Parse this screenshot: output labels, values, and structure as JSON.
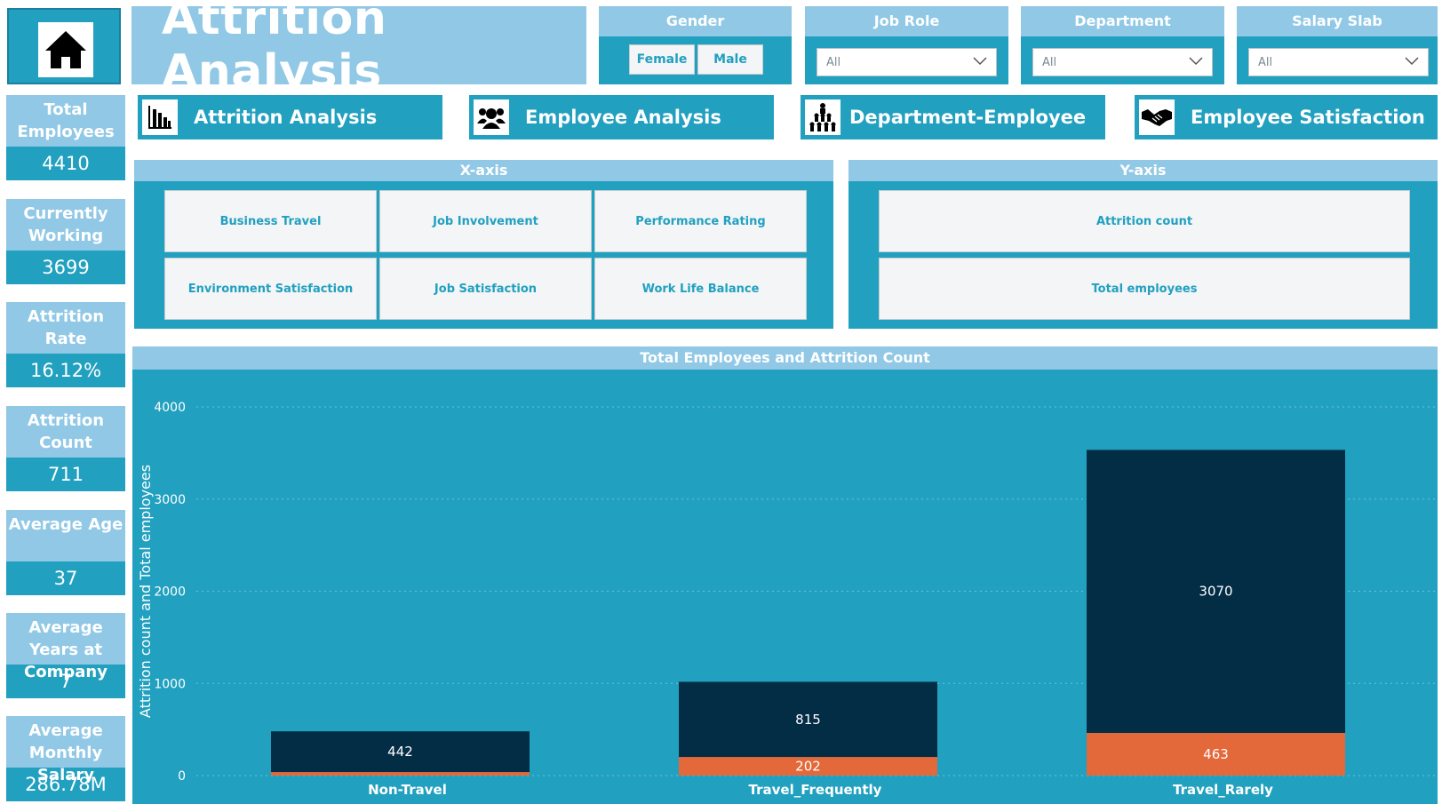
{
  "app": {
    "title": "Attrition Analysis"
  },
  "filters": {
    "gender": {
      "label": "Gender",
      "options": [
        "Female",
        "Male"
      ]
    },
    "job_role": {
      "label": "Job Role",
      "value": "All"
    },
    "department": {
      "label": "Department",
      "value": "All"
    },
    "salary_slab": {
      "label": "Salary Slab",
      "value": "All"
    }
  },
  "nav": [
    {
      "label": "Attrition Analysis",
      "icon": "bar-chart-icon"
    },
    {
      "label": "Employee Analysis",
      "icon": "people-icon"
    },
    {
      "label": "Department-Employee",
      "icon": "org-group-icon"
    },
    {
      "label": "Employee Satisfaction",
      "icon": "handshake-icon"
    }
  ],
  "kpis": [
    {
      "label": "Total Employees",
      "value": "4410"
    },
    {
      "label": "Currently Working",
      "value": "3699"
    },
    {
      "label": "Attrition Rate",
      "value": "16.12%"
    },
    {
      "label": "Attrition Count",
      "value": "711"
    },
    {
      "label": "Average Age",
      "value": "37"
    },
    {
      "label": "Average Years at Company",
      "value": "7"
    },
    {
      "label": "Average Monthly Salary",
      "value": "286.78M"
    }
  ],
  "x_axis": {
    "title": "X-axis",
    "options": [
      "Business Travel",
      "Job Involvement",
      "Performance Rating",
      "Environment Satisfaction",
      "Job Satisfaction",
      "Work Life Balance"
    ]
  },
  "y_axis": {
    "title": "Y-axis",
    "options": [
      "Attrition count",
      "Total employees"
    ]
  },
  "colors": {
    "teal": "#21a0bf",
    "light": "#90c8e6",
    "navy": "#032c45",
    "orange": "#e3683a"
  },
  "chart_data": {
    "type": "bar",
    "stacked": true,
    "title": "Total Employees and Attrition Count",
    "xlabel": "Business Travel",
    "ylabel": "Attrition count and Total employees",
    "categories": [
      "Non-Travel",
      "Travel_Frequently",
      "Travel_Rarely"
    ],
    "series": [
      {
        "values": [
          38,
          202,
          463
        ],
        "color": "#e3683a",
        "labels": [
          "",
          "202",
          "463"
        ]
      },
      {
        "values": [
          442,
          815,
          3070
        ],
        "color": "#032c45",
        "labels": [
          "442",
          "815",
          "3070"
        ]
      }
    ],
    "ylim": [
      0,
      4000
    ],
    "yticks": [
      0,
      1000,
      2000,
      3000,
      4000
    ],
    "grid": true
  }
}
